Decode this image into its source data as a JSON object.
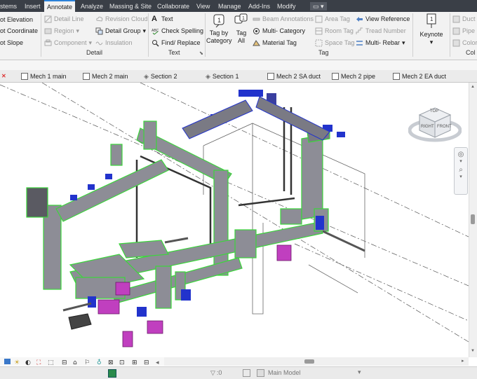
{
  "ribbon_tabs": [
    {
      "label": "stems",
      "active": false
    },
    {
      "label": "Insert",
      "active": false
    },
    {
      "label": "Annotate",
      "active": true
    },
    {
      "label": "Analyze",
      "active": false
    },
    {
      "label": "Massing & Site",
      "active": false
    },
    {
      "label": "Collaborate",
      "active": false
    },
    {
      "label": "View",
      "active": false
    },
    {
      "label": "Manage",
      "active": false
    },
    {
      "label": "Add-Ins",
      "active": false
    },
    {
      "label": "Modify",
      "active": false
    }
  ],
  "panels": {
    "dimension": {
      "items": [
        "ot  Elevation",
        "ot  Coordinate",
        "ot  Slope"
      ]
    },
    "detail": {
      "label": "Detail",
      "items": [
        "Detail  Line",
        "Region",
        "Component",
        "Revision  Cloud",
        "Detail  Group",
        "Insulation"
      ]
    },
    "text": {
      "label": "Text",
      "items": [
        "Text",
        "Check  Spelling",
        "Find/  Replace"
      ]
    },
    "tag": {
      "label": "Tag",
      "tag_by_category": [
        "Tag by",
        "Category"
      ],
      "tag_all": [
        "Tag",
        "All"
      ],
      "items": [
        "Beam  Annotations",
        "Multi- Category",
        "Material  Tag",
        "Area  Tag",
        "Room  Tag",
        "Space  Tag",
        "View  Reference",
        "Tread  Number",
        "Multi- Rebar"
      ]
    },
    "keynote": {
      "label": "Keynote"
    },
    "color_fill": {
      "items": [
        "Duct",
        "Pipe",
        "Color"
      ],
      "label": "Col"
    }
  },
  "view_tabs": [
    {
      "label": "Mech 1 main"
    },
    {
      "label": "Mech 2 main"
    },
    {
      "label": "Section 2"
    },
    {
      "label": "Section 1"
    },
    {
      "label": "Mech 2 SA duct"
    },
    {
      "label": "Mech 2 pipe"
    },
    {
      "label": "Mech 2 EA duct"
    }
  ],
  "viewcube": {
    "top": "TOP",
    "left": "RIGHT",
    "right": "FRONT"
  },
  "status": {
    "filter": ":0",
    "model": "Main Model"
  },
  "colors": {
    "duct_outline": "#3bd63b",
    "duct_fill": "#8d8d96",
    "flange": "#2233cc",
    "equipment": "#c03fbf",
    "tab_active": "#2b82d9"
  }
}
